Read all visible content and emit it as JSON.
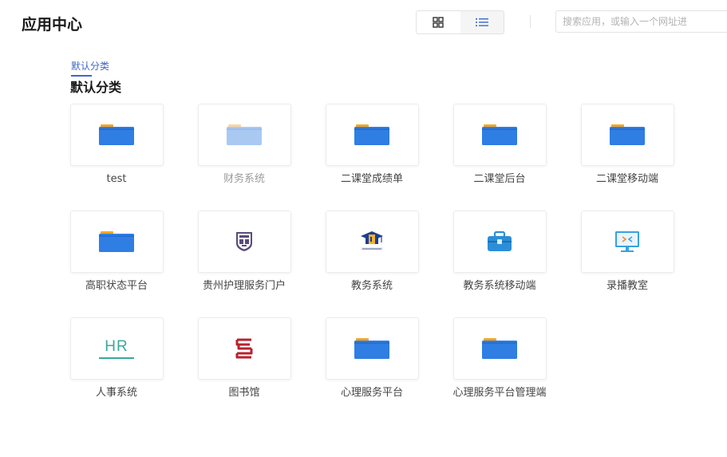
{
  "header": {
    "title": "应用中心",
    "search_placeholder": "搜索应用，或输入一个网址进"
  },
  "category": {
    "tab_label": "默认分类",
    "section_title": "默认分类"
  },
  "colors": {
    "accent": "#3f66c9",
    "folder_blue": "#2f7ee3",
    "folder_tab": "#f5a623"
  },
  "apps": [
    {
      "label": "test",
      "icon": "folder-icon"
    },
    {
      "label": "财务系统",
      "icon": "folder-light-icon"
    },
    {
      "label": "二课堂成绩单",
      "icon": "folder-icon"
    },
    {
      "label": "二课堂后台",
      "icon": "folder-icon"
    },
    {
      "label": "二课堂移动端",
      "icon": "folder-icon"
    },
    {
      "label": "高职状态平台",
      "icon": "folder-icon"
    },
    {
      "label": "贵州护理服务门户",
      "icon": "school-crest-icon"
    },
    {
      "label": "教务系统",
      "icon": "graduation-cap-icon"
    },
    {
      "label": "教务系统移动端",
      "icon": "briefcase-icon"
    },
    {
      "label": "录播教室",
      "icon": "monitor-icon"
    },
    {
      "label": "人事系统",
      "icon": "hr-icon",
      "icon_text": "HR"
    },
    {
      "label": "图书馆",
      "icon": "library-logo-icon"
    },
    {
      "label": "心理服务平台",
      "icon": "folder-icon"
    },
    {
      "label": "心理服务平台管理端",
      "icon": "folder-icon"
    }
  ]
}
